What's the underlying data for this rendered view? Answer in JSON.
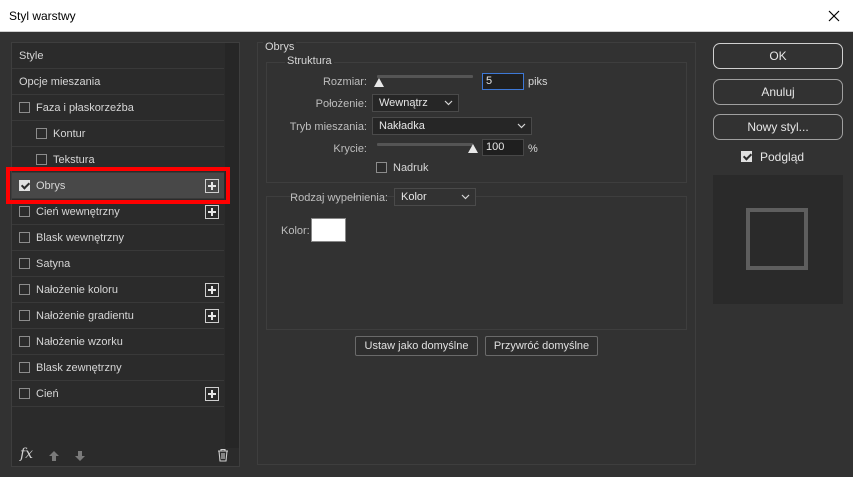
{
  "window": {
    "title": "Styl warstwy"
  },
  "styles_list": {
    "items": [
      {
        "label": "Style",
        "checkbox": false,
        "checked": false,
        "indent": false,
        "plus": false,
        "selected": false
      },
      {
        "label": "Opcje mieszania",
        "checkbox": false,
        "checked": false,
        "indent": false,
        "plus": false,
        "selected": false
      },
      {
        "label": "Faza i płaskorzeźba",
        "checkbox": true,
        "checked": false,
        "indent": false,
        "plus": false,
        "selected": false
      },
      {
        "label": "Kontur",
        "checkbox": true,
        "checked": false,
        "indent": true,
        "plus": false,
        "selected": false
      },
      {
        "label": "Tekstura",
        "checkbox": true,
        "checked": false,
        "indent": true,
        "plus": false,
        "selected": false
      },
      {
        "label": "Obrys",
        "checkbox": true,
        "checked": true,
        "indent": false,
        "plus": true,
        "selected": true
      },
      {
        "label": "Cień wewnętrzny",
        "checkbox": true,
        "checked": false,
        "indent": false,
        "plus": true,
        "selected": false
      },
      {
        "label": "Blask wewnętrzny",
        "checkbox": true,
        "checked": false,
        "indent": false,
        "plus": false,
        "selected": false
      },
      {
        "label": "Satyna",
        "checkbox": true,
        "checked": false,
        "indent": false,
        "plus": false,
        "selected": false
      },
      {
        "label": "Nałożenie koloru",
        "checkbox": true,
        "checked": false,
        "indent": false,
        "plus": true,
        "selected": false
      },
      {
        "label": "Nałożenie gradientu",
        "checkbox": true,
        "checked": false,
        "indent": false,
        "plus": true,
        "selected": false
      },
      {
        "label": "Nałożenie wzorku",
        "checkbox": true,
        "checked": false,
        "indent": false,
        "plus": false,
        "selected": false
      },
      {
        "label": "Blask zewnętrzny",
        "checkbox": true,
        "checked": false,
        "indent": false,
        "plus": false,
        "selected": false
      },
      {
        "label": "Cień",
        "checkbox": true,
        "checked": false,
        "indent": false,
        "plus": true,
        "selected": false
      }
    ],
    "bottom_icons": [
      "fx-icon",
      "arrow-up-icon",
      "arrow-down-icon",
      "trash-icon"
    ],
    "fx_label": "fx"
  },
  "stroke": {
    "title": "Obrys",
    "structure_title": "Struktura",
    "size_label": "Rozmiar:",
    "size_value": "5",
    "size_unit": "piks",
    "size_slider_fraction": 0.02,
    "position_label": "Położenie:",
    "position_value": "Wewnątrz",
    "blend_label": "Tryb mieszania:",
    "blend_value": "Nakładka",
    "opacity_label": "Krycie:",
    "opacity_value": "100",
    "opacity_unit": "%",
    "opacity_slider_fraction": 1.0,
    "overprint_label": "Nadruk",
    "overprint_checked": false,
    "fill_type_label": "Rodzaj wypełnienia:",
    "fill_type_value": "Kolor",
    "color_label": "Kolor:",
    "color_value": "#ffffff",
    "set_default_label": "Ustaw jako domyślne",
    "reset_default_label": "Przywróć domyślne"
  },
  "actions": {
    "ok_label": "OK",
    "cancel_label": "Anuluj",
    "new_style_label": "Nowy styl...",
    "preview_label": "Podgląd",
    "preview_checked": true
  },
  "colors": {
    "accent_focus": "#3d78d6",
    "highlight": "#ff0000"
  }
}
